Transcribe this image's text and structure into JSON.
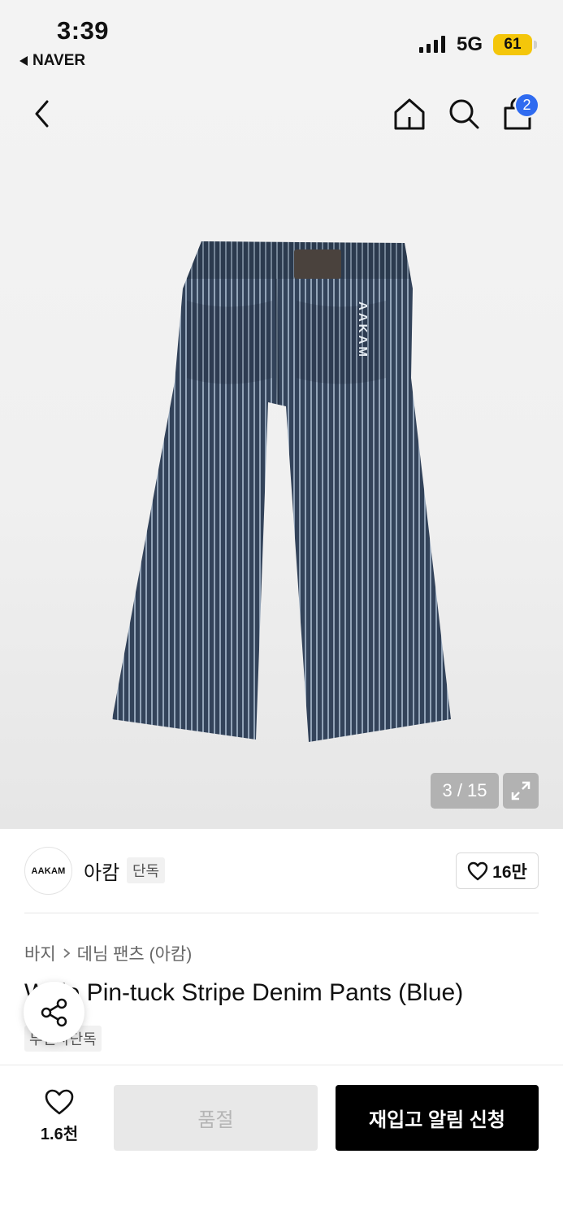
{
  "status_bar": {
    "time": "3:39",
    "back_app": "NAVER",
    "network": "5G",
    "battery": "61"
  },
  "nav": {
    "cart_count": "2",
    "icons": [
      "back-icon",
      "home-icon",
      "search-icon",
      "cart-icon"
    ]
  },
  "gallery": {
    "counter": "3 / 15",
    "image_logo_text": "AAKAM"
  },
  "brand": {
    "logo_text": "AAKAM",
    "name": "아캄",
    "tag": "단독",
    "favorite_count": "16만"
  },
  "product": {
    "breadcrumb": [
      "바지",
      "데님 팬츠 (아캄)"
    ],
    "title": "Wide Pin-tuck Stripe Denim Pants (Blue)",
    "tag": "무신사단독"
  },
  "bottom": {
    "wish_count": "1.6천",
    "soldout_label": "품절",
    "restock_label": "재입고 알림 신청"
  },
  "colors": {
    "accent_badge": "#2f6bf0",
    "battery": "#f4c60a",
    "denim": "#3d4d62"
  }
}
